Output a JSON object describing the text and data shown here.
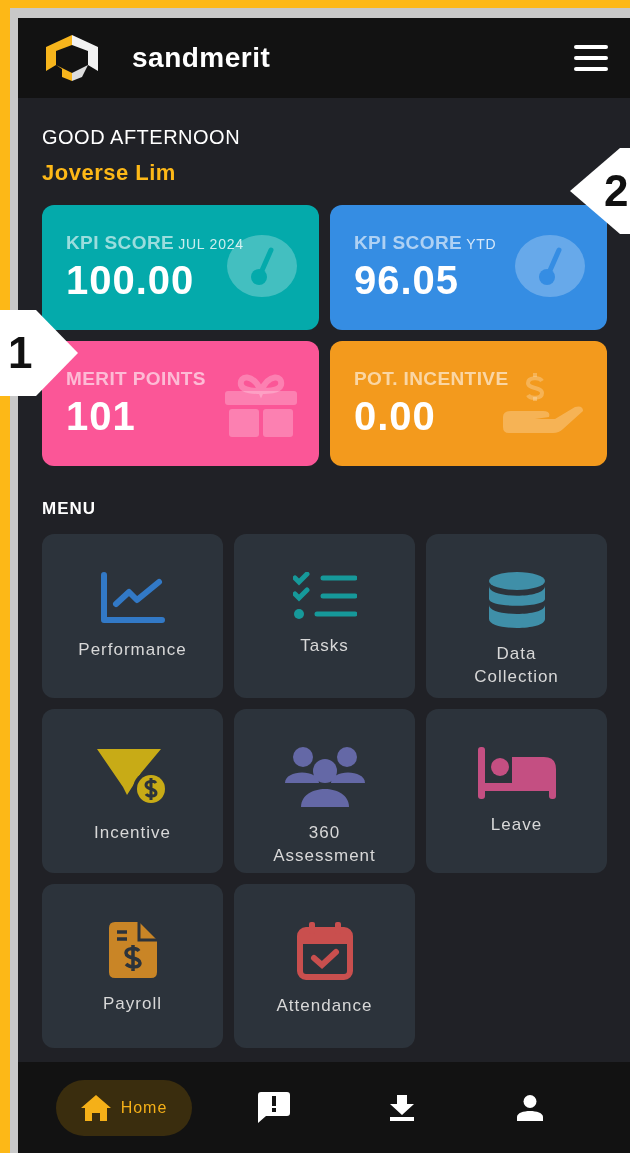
{
  "header": {
    "title": "sandmerit"
  },
  "greeting": "GOOD AFTERNOON",
  "user_name": "Joverse Lim",
  "stats": [
    {
      "label": "KPI SCORE",
      "sublabel": "JUL 2024",
      "value": "100.00",
      "color": "#04aaab",
      "kind": "gauge"
    },
    {
      "label": "KPI SCORE",
      "sublabel": "YTD",
      "value": "96.05",
      "color": "#358de3",
      "kind": "gauge"
    },
    {
      "label": "MERIT POINTS",
      "value": "101",
      "color": "#fb5697",
      "kind": "gift"
    },
    {
      "label": "POT. INCENTIVE",
      "value": "0.00",
      "color": "#f39a1d",
      "kind": "money"
    }
  ],
  "menu": {
    "title": "MENU",
    "items": [
      {
        "label": "Performance",
        "kind": "chart",
        "color": "#3279c6"
      },
      {
        "label": "Tasks",
        "kind": "tasks",
        "color": "#16999a"
      },
      {
        "label": "Data Collection",
        "kind": "database",
        "color": "#3f8fa8"
      },
      {
        "label": "Incentive",
        "kind": "funnel",
        "color": "#c8ab16"
      },
      {
        "label": "360 Assessment",
        "kind": "people",
        "color": "#6468a6"
      },
      {
        "label": "Leave",
        "kind": "bed",
        "color": "#c44f82"
      },
      {
        "label": "Payroll",
        "kind": "invoice",
        "color": "#c98526"
      },
      {
        "label": "Attendance",
        "kind": "calendar",
        "color": "#c94f4e"
      }
    ]
  },
  "bottom_nav": [
    {
      "kind": "home",
      "label": "Home",
      "selected": true
    },
    {
      "kind": "feedback",
      "selected": false
    },
    {
      "kind": "download",
      "selected": false
    },
    {
      "kind": "profile",
      "selected": false
    }
  ],
  "callouts": [
    {
      "text": "1",
      "kind": "left"
    },
    {
      "text": "2",
      "kind": "right"
    }
  ]
}
